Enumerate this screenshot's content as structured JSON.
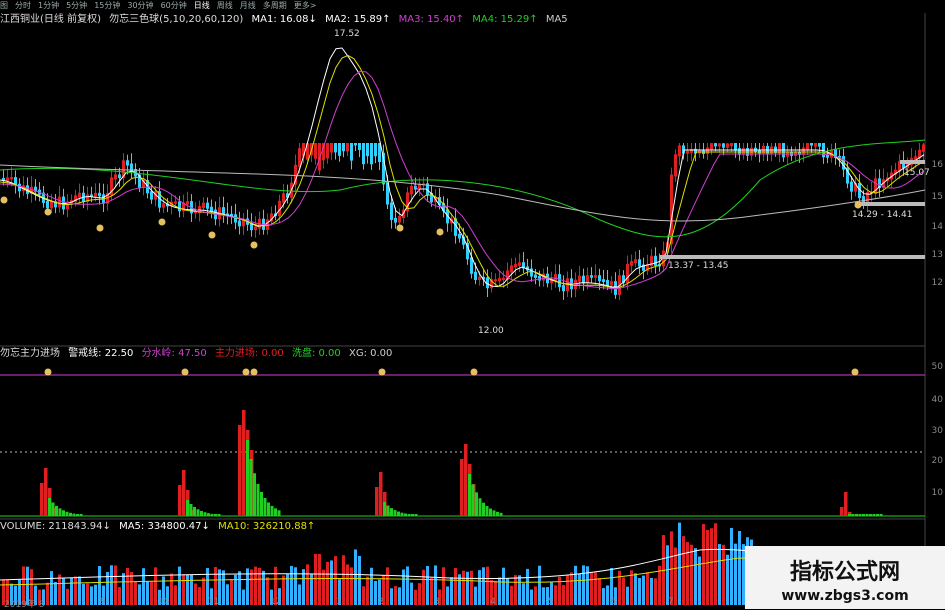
{
  "toolbar": {
    "items": [
      "图",
      "分时",
      "1分钟",
      "5分钟",
      "15分钟",
      "30分钟",
      "60分钟",
      "日线",
      "周线",
      "月线",
      "多周期",
      "更多>"
    ]
  },
  "main_header": {
    "stock": "江西铜业(日线 前复权)",
    "indicator": "勿忘三色球(5,10,20,60,120)",
    "ma1": "MA1: 16.08↓",
    "ma2": "MA2: 15.89↑",
    "ma3": "MA3: 15.40↑",
    "ma4": "MA4: 15.29↑",
    "ma5": "MA5"
  },
  "annotations": {
    "high": "17.52",
    "low_left": "12.00",
    "range1": "13.37 - 13.45",
    "range2": "14.29 - 14.41",
    "right_price": "15.07"
  },
  "price_axis": [
    "16",
    "15",
    "14",
    "13",
    "12"
  ],
  "indicator_header": {
    "name": "勿忘主力进场",
    "warn": "警戒线: 22.50",
    "water": "分水岭: 47.50",
    "main": "主力进场: 0.00",
    "wash": "洗盘: 0.00",
    "xg": "XG: 0.00"
  },
  "indicator_axis": [
    "50",
    "40",
    "30",
    "20",
    "10"
  ],
  "volume_header": {
    "volume": "VOLUME: 211843.94↓",
    "ma5": "MA5: 334800.47↓",
    "ma10": "MA10: 326210.88↑"
  },
  "date_axis": [
    "2019年 8",
    "9",
    "10",
    "11",
    "12",
    "1",
    "2",
    "3",
    "4",
    "5",
    "6",
    "7"
  ],
  "watermark": {
    "title": "指标公式网",
    "url": "www.zbgs3.com"
  },
  "colors": {
    "up": "#e02020",
    "down": "#30d0ff",
    "ma1": "#ffffff",
    "ma2": "#e0e000",
    "ma3": "#d040d0",
    "ma4": "#20d020",
    "ma5": "#c0c0c0"
  }
}
